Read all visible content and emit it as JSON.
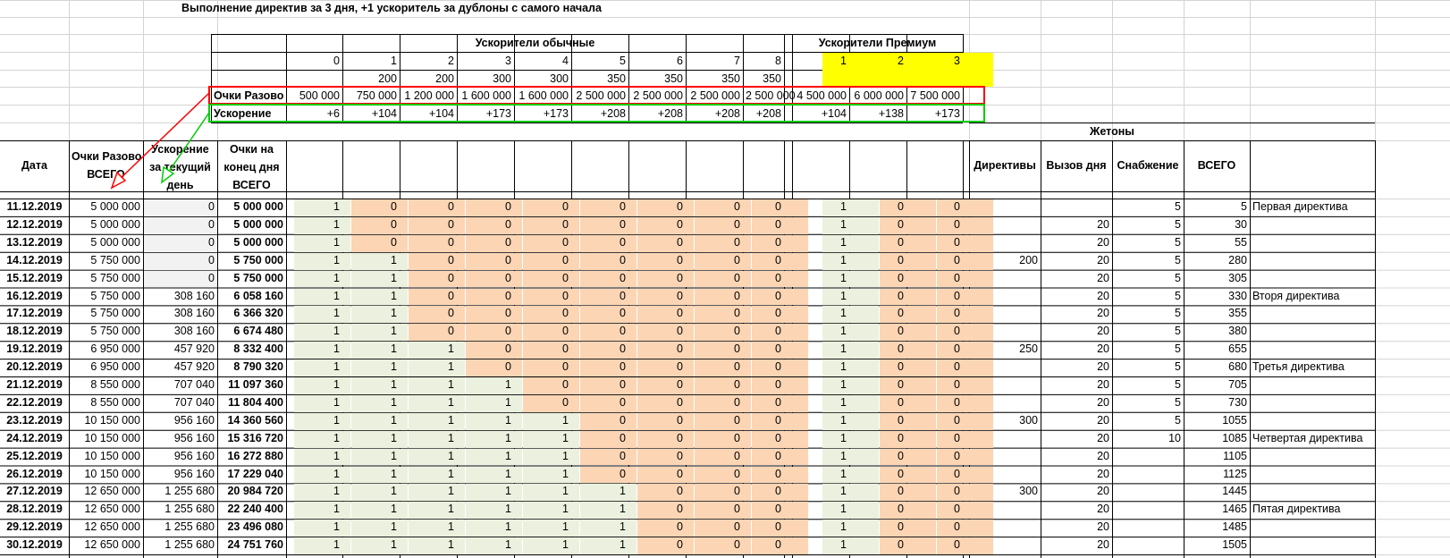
{
  "title": "Выполнение директив за 3 дня,   +1 ускоритель за дублоны с самого начала",
  "accelerators": {
    "normal_title": "Ускорители обычные",
    "premium_title": "Ускорители Премиум",
    "normal_levels": [
      "0",
      "1",
      "2",
      "3",
      "4",
      "5",
      "6",
      "7",
      "8"
    ],
    "normal_costs": [
      "",
      "200",
      "200",
      "300",
      "300",
      "350",
      "350",
      "350",
      "350"
    ],
    "premium_levels": [
      "1",
      "2",
      "3"
    ],
    "row_points_label": "Очки Разово",
    "points": [
      "500 000",
      "750 000",
      "1 200 000",
      "1 600 000",
      "1 600 000",
      "2 500 000",
      "2 500 000",
      "2 500 000",
      "2 500 000",
      "4 500 000",
      "6 000 000",
      "7 500 000"
    ],
    "row_boost_label": "Ускорение",
    "boost": [
      "+6",
      "+104",
      "+104",
      "+173",
      "+173",
      "+208",
      "+208",
      "+208",
      "+208",
      "+104",
      "+138",
      "+173"
    ]
  },
  "table": {
    "col_date": "Дата",
    "col_points_total": [
      "Очки Разово",
      "ВСЕГО"
    ],
    "col_boost_today": [
      "Ускорение",
      "за текущий",
      "день"
    ],
    "col_points_end": [
      "Очки на",
      "конец дня",
      "ВСЕГО"
    ],
    "tokens_title": "Жетоны",
    "tokens_cols": [
      "Директивы",
      "Вызов дня",
      "Снабжение",
      "ВСЕГО"
    ],
    "rows": [
      {
        "date": "11.12.2019",
        "pts": "5 000 000",
        "boost": "0",
        "end": "5 000 000",
        "acc": [
          1,
          0,
          0,
          0,
          0,
          0,
          0,
          0,
          0,
          1,
          0,
          0
        ],
        "dir": "",
        "call": "",
        "supply": "5",
        "total": "5",
        "note": "Первая директива"
      },
      {
        "date": "12.12.2019",
        "pts": "5 000 000",
        "boost": "0",
        "end": "5 000 000",
        "acc": [
          1,
          0,
          0,
          0,
          0,
          0,
          0,
          0,
          0,
          1,
          0,
          0
        ],
        "dir": "",
        "call": "20",
        "supply": "5",
        "total": "30",
        "note": ""
      },
      {
        "date": "13.12.2019",
        "pts": "5 000 000",
        "boost": "0",
        "end": "5 000 000",
        "acc": [
          1,
          0,
          0,
          0,
          0,
          0,
          0,
          0,
          0,
          1,
          0,
          0
        ],
        "dir": "",
        "call": "20",
        "supply": "5",
        "total": "55",
        "note": ""
      },
      {
        "date": "14.12.2019",
        "pts": "5 750 000",
        "boost": "0",
        "end": "5 750 000",
        "acc": [
          1,
          1,
          0,
          0,
          0,
          0,
          0,
          0,
          0,
          1,
          0,
          0
        ],
        "dir": "200",
        "call": "20",
        "supply": "5",
        "total": "280",
        "note": ""
      },
      {
        "date": "15.12.2019",
        "pts": "5 750 000",
        "boost": "0",
        "end": "5 750 000",
        "acc": [
          1,
          1,
          0,
          0,
          0,
          0,
          0,
          0,
          0,
          1,
          0,
          0
        ],
        "dir": "",
        "call": "20",
        "supply": "5",
        "total": "305",
        "note": ""
      },
      {
        "date": "16.12.2019",
        "pts": "5 750 000",
        "boost": "308 160",
        "end": "6 058 160",
        "acc": [
          1,
          1,
          0,
          0,
          0,
          0,
          0,
          0,
          0,
          1,
          0,
          0
        ],
        "dir": "",
        "call": "20",
        "supply": "5",
        "total": "330",
        "note": "Вторя директива"
      },
      {
        "date": "17.12.2019",
        "pts": "5 750 000",
        "boost": "308 160",
        "end": "6 366 320",
        "acc": [
          1,
          1,
          0,
          0,
          0,
          0,
          0,
          0,
          0,
          1,
          0,
          0
        ],
        "dir": "",
        "call": "20",
        "supply": "5",
        "total": "355",
        "note": ""
      },
      {
        "date": "18.12.2019",
        "pts": "5 750 000",
        "boost": "308 160",
        "end": "6 674 480",
        "acc": [
          1,
          1,
          0,
          0,
          0,
          0,
          0,
          0,
          0,
          1,
          0,
          0
        ],
        "dir": "",
        "call": "20",
        "supply": "5",
        "total": "380",
        "note": ""
      },
      {
        "date": "19.12.2019",
        "pts": "6 950 000",
        "boost": "457 920",
        "end": "8 332 400",
        "acc": [
          1,
          1,
          1,
          0,
          0,
          0,
          0,
          0,
          0,
          1,
          0,
          0
        ],
        "dir": "250",
        "call": "20",
        "supply": "5",
        "total": "655",
        "note": ""
      },
      {
        "date": "20.12.2019",
        "pts": "6 950 000",
        "boost": "457 920",
        "end": "8 790 320",
        "acc": [
          1,
          1,
          1,
          0,
          0,
          0,
          0,
          0,
          0,
          1,
          0,
          0
        ],
        "dir": "",
        "call": "20",
        "supply": "5",
        "total": "680",
        "note": "Третья директива"
      },
      {
        "date": "21.12.2019",
        "pts": "8 550 000",
        "boost": "707 040",
        "end": "11 097 360",
        "acc": [
          1,
          1,
          1,
          1,
          0,
          0,
          0,
          0,
          0,
          1,
          0,
          0
        ],
        "dir": "",
        "call": "20",
        "supply": "5",
        "total": "705",
        "note": ""
      },
      {
        "date": "22.12.2019",
        "pts": "8 550 000",
        "boost": "707 040",
        "end": "11 804 400",
        "acc": [
          1,
          1,
          1,
          1,
          0,
          0,
          0,
          0,
          0,
          1,
          0,
          0
        ],
        "dir": "",
        "call": "20",
        "supply": "5",
        "total": "730",
        "note": ""
      },
      {
        "date": "23.12.2019",
        "pts": "10 150 000",
        "boost": "956 160",
        "end": "14 360 560",
        "acc": [
          1,
          1,
          1,
          1,
          1,
          0,
          0,
          0,
          0,
          1,
          0,
          0
        ],
        "dir": "300",
        "call": "20",
        "supply": "5",
        "total": "1055",
        "note": ""
      },
      {
        "date": "24.12.2019",
        "pts": "10 150 000",
        "boost": "956 160",
        "end": "15 316 720",
        "acc": [
          1,
          1,
          1,
          1,
          1,
          0,
          0,
          0,
          0,
          1,
          0,
          0
        ],
        "dir": "",
        "call": "20",
        "supply": "10",
        "total": "1085",
        "note": "Четвертая директива"
      },
      {
        "date": "25.12.2019",
        "pts": "10 150 000",
        "boost": "956 160",
        "end": "16 272 880",
        "acc": [
          1,
          1,
          1,
          1,
          1,
          0,
          0,
          0,
          0,
          1,
          0,
          0
        ],
        "dir": "",
        "call": "20",
        "supply": "",
        "total": "1105",
        "note": ""
      },
      {
        "date": "26.12.2019",
        "pts": "10 150 000",
        "boost": "956 160",
        "end": "17 229 040",
        "acc": [
          1,
          1,
          1,
          1,
          1,
          0,
          0,
          0,
          0,
          1,
          0,
          0
        ],
        "dir": "",
        "call": "20",
        "supply": "",
        "total": "1125",
        "note": ""
      },
      {
        "date": "27.12.2019",
        "pts": "12 650 000",
        "boost": "1 255 680",
        "end": "20 984 720",
        "acc": [
          1,
          1,
          1,
          1,
          1,
          1,
          0,
          0,
          0,
          1,
          0,
          0
        ],
        "dir": "300",
        "call": "20",
        "supply": "",
        "total": "1445",
        "note": ""
      },
      {
        "date": "28.12.2019",
        "pts": "12 650 000",
        "boost": "1 255 680",
        "end": "22 240 400",
        "acc": [
          1,
          1,
          1,
          1,
          1,
          1,
          0,
          0,
          0,
          1,
          0,
          0
        ],
        "dir": "",
        "call": "20",
        "supply": "",
        "total": "1465",
        "note": "Пятая директива"
      },
      {
        "date": "29.12.2019",
        "pts": "12 650 000",
        "boost": "1 255 680",
        "end": "23 496 080",
        "acc": [
          1,
          1,
          1,
          1,
          1,
          1,
          0,
          0,
          0,
          1,
          0,
          0
        ],
        "dir": "",
        "call": "20",
        "supply": "",
        "total": "1485",
        "note": ""
      },
      {
        "date": "30.12.2019",
        "pts": "12 650 000",
        "boost": "1 255 680",
        "end": "24 751 760",
        "acc": [
          1,
          1,
          1,
          1,
          1,
          1,
          0,
          0,
          0,
          1,
          0,
          0
        ],
        "dir": "",
        "call": "20",
        "supply": "",
        "total": "1505",
        "note": ""
      }
    ]
  },
  "colors": {
    "active": "#ebf1de",
    "inactive": "#fcd5b4",
    "premium_header": "#ffff00",
    "points_frame": "#ff0000",
    "boost_frame": "#00cc00"
  }
}
